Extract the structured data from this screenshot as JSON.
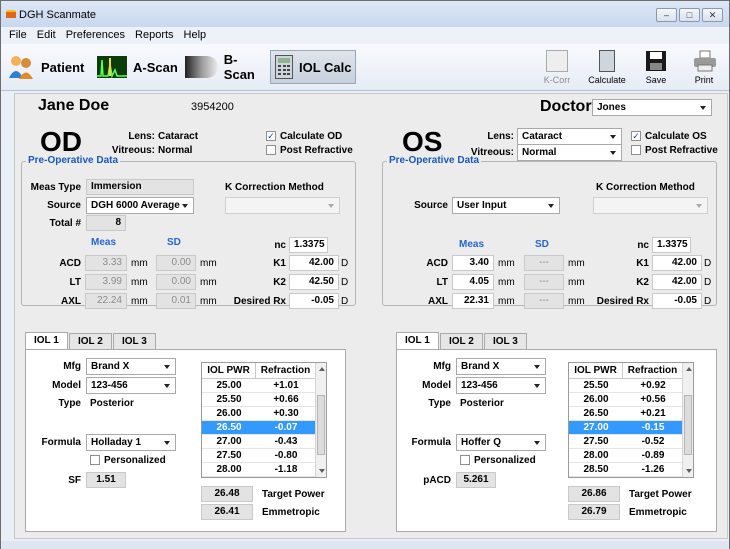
{
  "window": {
    "title": "DGH Scanmate"
  },
  "menu": [
    "File",
    "Edit",
    "Preferences",
    "Reports",
    "Help"
  ],
  "toolbar": {
    "patient": "Patient",
    "ascan": "A-Scan",
    "bscan": "B-Scan",
    "iolcalc": "IOL Calc",
    "kcorr": "K-Corr",
    "calculate": "Calculate",
    "save": "Save",
    "print": "Print"
  },
  "patient": {
    "name": "Jane Doe",
    "id": "3954200",
    "doctor_label": "Doctor",
    "doctor": "Jones"
  },
  "od": {
    "title": "OD",
    "lens_label": "Lens:",
    "lens": "Cataract",
    "vitreous_label": "Vitreous:",
    "vitreous": "Normal",
    "calc_label": "Calculate OD",
    "calc_checked": true,
    "postref_label": "Post Refractive",
    "postref_checked": false,
    "preop_title": "Pre-Operative Data",
    "meas_type_label": "Meas Type",
    "meas_type": "Immersion",
    "source_label": "Source",
    "source": "DGH 6000 Average",
    "total_label": "Total #",
    "total": "8",
    "kcorr_label": "K Correction Method",
    "meas_hdr": "Meas",
    "sd_hdr": "SD",
    "acd_label": "ACD",
    "acd": "3.33",
    "acd_sd": "0.00",
    "lt_label": "LT",
    "lt": "3.99",
    "lt_sd": "0.00",
    "axl_label": "AXL",
    "axl": "22.24",
    "axl_sd": "0.01",
    "mm": "mm",
    "nc_label": "nc",
    "nc": "1.3375",
    "k1_label": "K1",
    "k1": "42.00",
    "k2_label": "K2",
    "k2": "42.50",
    "d": "D",
    "rx_label": "Desired Rx",
    "rx": "-0.05",
    "tabs": [
      "IOL 1",
      "IOL 2",
      "IOL 3"
    ],
    "mfg_label": "Mfg",
    "mfg": "Brand X",
    "model_label": "Model",
    "model": "123-456",
    "type_label": "Type",
    "type": "Posterior",
    "formula_label": "Formula",
    "formula": "Holladay 1",
    "personalized_label": "Personalized",
    "const_label": "SF",
    "const": "1.51",
    "table": {
      "h1": "IOL PWR",
      "h2": "Refraction",
      "rows": [
        [
          "25.00",
          "+1.01"
        ],
        [
          "25.50",
          "+0.66"
        ],
        [
          "26.00",
          "+0.30"
        ],
        [
          "26.50",
          "-0.07"
        ],
        [
          "27.00",
          "-0.43"
        ],
        [
          "27.50",
          "-0.80"
        ],
        [
          "28.00",
          "-1.18"
        ]
      ],
      "selected": 3
    },
    "target_power": "26.48",
    "target_label": "Target Power",
    "emmetropic": "26.41",
    "emm_label": "Emmetropic"
  },
  "os": {
    "title": "OS",
    "lens_label": "Lens:",
    "lens": "Cataract",
    "vitreous_label": "Vitreous:",
    "vitreous": "Normal",
    "calc_label": "Calculate OS",
    "calc_checked": true,
    "postref_label": "Post Refractive",
    "postref_checked": false,
    "preop_title": "Pre-Operative Data",
    "source_label": "Source",
    "source": "User Input",
    "kcorr_label": "K Correction Method",
    "meas_hdr": "Meas",
    "sd_hdr": "SD",
    "acd_label": "ACD",
    "acd": "3.40",
    "acd_sd": "---",
    "lt_label": "LT",
    "lt": "4.05",
    "lt_sd": "---",
    "axl_label": "AXL",
    "axl": "22.31",
    "axl_sd": "---",
    "mm": "mm",
    "nc_label": "nc",
    "nc": "1.3375",
    "k1_label": "K1",
    "k1": "42.00",
    "k2_label": "K2",
    "k2": "42.00",
    "d": "D",
    "rx_label": "Desired Rx",
    "rx": "-0.05",
    "tabs": [
      "IOL 1",
      "IOL 2",
      "IOL 3"
    ],
    "mfg_label": "Mfg",
    "mfg": "Brand X",
    "model_label": "Model",
    "model": "123-456",
    "type_label": "Type",
    "type": "Posterior",
    "formula_label": "Formula",
    "formula": "Hoffer Q",
    "personalized_label": "Personalized",
    "const_label": "pACD",
    "const": "5.261",
    "table": {
      "h1": "IOL PWR",
      "h2": "Refraction",
      "rows": [
        [
          "25.50",
          "+0.92"
        ],
        [
          "26.00",
          "+0.56"
        ],
        [
          "26.50",
          "+0.21"
        ],
        [
          "27.00",
          "-0.15"
        ],
        [
          "27.50",
          "-0.52"
        ],
        [
          "28.00",
          "-0.89"
        ],
        [
          "28.50",
          "-1.26"
        ]
      ],
      "selected": 3
    },
    "target_power": "26.86",
    "target_label": "Target Power",
    "emmetropic": "26.79",
    "emm_label": "Emmetropic"
  },
  "colors": {
    "accent_blue": "#1b57b8",
    "selected_row": "#3399ff"
  }
}
